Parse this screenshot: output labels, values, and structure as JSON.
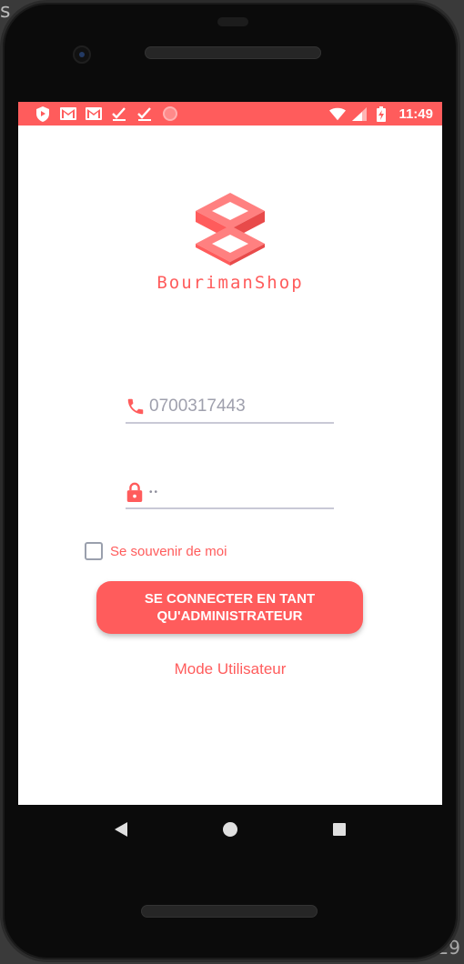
{
  "status_bar": {
    "time": "11:49",
    "left_icons": [
      "shield-icon",
      "gmail-icon",
      "gmail-icon",
      "check-icon",
      "check-icon",
      "record-icon"
    ],
    "right_icons": [
      "wifi-icon",
      "signal-icon",
      "battery-charging-icon"
    ]
  },
  "brand": {
    "name": "BourimanShop"
  },
  "form": {
    "phone_value": "0700317443",
    "password_value": "••",
    "remember_label": "Se souvenir de moi",
    "remember_checked": false,
    "submit_label": "SE CONNECTER EN TANT QU'ADMINISTRATEUR",
    "user_mode_link": "Mode Utilisateur"
  },
  "theme": {
    "accent": "#ff5c5c",
    "underline": "#c9c9d6"
  },
  "nav": {
    "buttons": [
      "back-icon",
      "home-icon",
      "recents-icon"
    ]
  }
}
